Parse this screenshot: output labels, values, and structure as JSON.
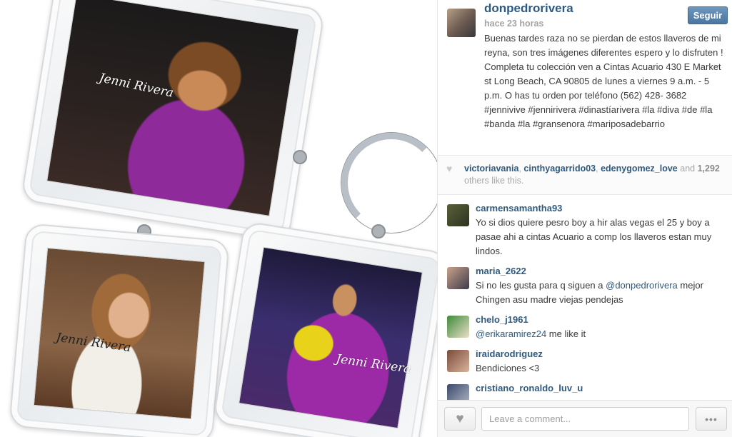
{
  "photo": {
    "signature_text": "Jenni Rivera"
  },
  "post": {
    "username": "donpedrorivera",
    "timestamp": "hace 23 horas",
    "follow_label": "Seguir",
    "caption": "Buenas tardes raza no se pierdan de estos llaveros de mi reyna, son tres imágenes diferentes espero y lo disfruten ! Completa tu colección ven a Cintas Acuario 430 E Market st Long Beach, CA 90805 de lunes a viernes 9 a.m. - 5 p.m. O has tu orden por teléfono (562) 428- 3682 #jennivive #jennirivera #dinastíarivera #la #diva #de #la #banda #la #gransenora #mariposadebarrio"
  },
  "likes": {
    "users": [
      "victoriavania",
      "cinthyagarrido03",
      "edenygomez_love"
    ],
    "separator": ", ",
    "and_text": "and",
    "count": "1,292",
    "suffix": "others like this."
  },
  "comments": [
    {
      "user": "carmensamantha93",
      "text": "Yo si dios quiere pesro boy a hir alas vegas el 25 y boy a pasae ahi a cintas Acuario a comp los llaveros estan muy lindos."
    },
    {
      "user": "maria_2622",
      "text_before": "Si no les gusta para q siguen a ",
      "mention": "@donpedrorivera",
      "text_after": " mejor Chingen asu madre viejas pendejas"
    },
    {
      "user": "chelo_j1961",
      "mention": "@erikaramirez24",
      "text_after": " me like it"
    },
    {
      "user": "iraidarodriguez",
      "text": "Bendiciones <3"
    },
    {
      "user": "cristiano_ronaldo_luv_u",
      "text": ""
    }
  ],
  "footer": {
    "comment_placeholder": "Leave a comment...",
    "like_icon": "heart-icon",
    "more_icon": "ellipsis-icon",
    "more_label": "•••",
    "heart_glyph": "♥"
  },
  "colors": {
    "username_blue": "#2f5a80",
    "follow_button": "#4a76a0",
    "muted_text": "#a4a4a4"
  }
}
